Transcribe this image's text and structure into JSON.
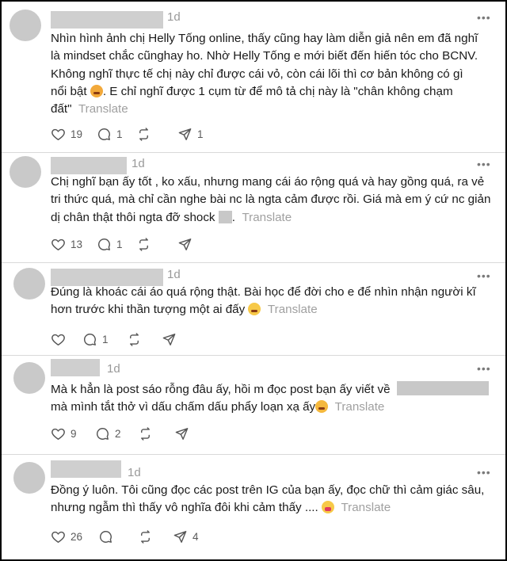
{
  "translate_label": "Translate",
  "more_label": "•••",
  "comments": [
    {
      "time": "1d",
      "text_lines": [
        "Nhìn hình ảnh chị Helly Tống online, thấy cũng hay làm diễn giả nên em đã nghĩ",
        "là mindset chắc cũnghay ho. Nhờ Helly Tống e mới biết đến hiến tóc cho BCNV.",
        "Không nghĩ thực tế chị này chỉ được cái vỏ, còn cái lõi thì cơ bản không có gì",
        "nổi bật",
        ". E chỉ nghĩ được 1 cụm từ để mô tả chị này là \"chân không chạm",
        "đất\""
      ],
      "likes": "19",
      "replies": "1",
      "reposts": "",
      "shares": "1"
    },
    {
      "time": "1d",
      "text_lines": [
        "Chị nghĩ bạn ấy tốt , ko xấu, nhưng mang cái áo rộng quá và hay gồng quá, ra vẻ",
        "tri thức quá, mà chỉ cần nghe bài nc là ngta cảm được rồi. Giá mà em ý cứ nc giản",
        "dị chân thật thôi ngta đỡ shock",
        "."
      ],
      "likes": "13",
      "replies": "1",
      "reposts": "",
      "shares": ""
    },
    {
      "time": "1d",
      "text_lines": [
        "Đúng là khoác cái áo quá rộng thật. Bài học để đời cho e để nhìn nhận người kĩ",
        "hơn trước khi thần tượng một ai đấy"
      ],
      "likes": "",
      "replies": "1",
      "reposts": "",
      "shares": ""
    },
    {
      "time": "1d",
      "text_lines": [
        "Mà k hẳn là post sáo rỗng đâu ấy, hồi m đọc post bạn ấy viết về",
        "mà mình tắt thở vì dấu chấm dấu phẩy loạn xạ ấy"
      ],
      "likes": "9",
      "replies": "2",
      "reposts": "",
      "shares": ""
    },
    {
      "time": "1d",
      "text_lines": [
        "Đồng ý luôn. Tôi cũng đọc các post trên IG của bạn ấy, đọc chữ thì cảm giác sâu,",
        "nhưng ngẫm thì thấy vô nghĩa đôi khi cảm thấy ...."
      ],
      "likes": "26",
      "replies": "",
      "reposts": "",
      "shares": "4"
    }
  ]
}
